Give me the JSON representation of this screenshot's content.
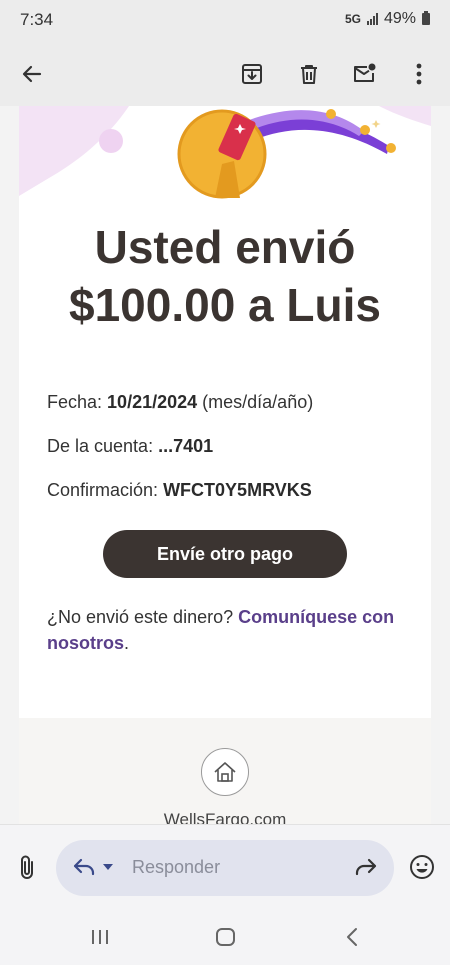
{
  "status_bar": {
    "time": "7:34",
    "network": "5G",
    "battery": "49%"
  },
  "icons": {
    "back": "arrow-left-icon",
    "archive": "archive-icon",
    "delete": "trash-icon",
    "unread": "mark-unread-icon",
    "more": "more-vertical-icon",
    "home": "home-icon",
    "attach": "paperclip-icon",
    "reply": "reply-icon",
    "forward": "forward-icon",
    "emoji": "emoji-icon"
  },
  "email": {
    "headline_line1": "Usted envió",
    "headline_line2": "$100.00 a Luis",
    "date_label": "Fecha:",
    "date_value": "10/21/2024",
    "date_format": "(mes/día/año)",
    "account_label": "De la cuenta:",
    "account_value": "...7401",
    "confirmation_label": "Confirmación:",
    "confirmation_value": "WFCT0Y5MRVKS",
    "cta_label": "Envíe otro pago",
    "help_text": "¿No envió este dinero?",
    "help_link": "Comuníquese con nosotros",
    "help_end": ".",
    "footer_link": "WellsFargo.com"
  },
  "reply": {
    "placeholder": "Responder"
  },
  "colors": {
    "primary": "#3b3431",
    "link": "#5a3f8a",
    "accent_yellow": "#f2b233",
    "accent_purple": "#7b3fd6"
  }
}
